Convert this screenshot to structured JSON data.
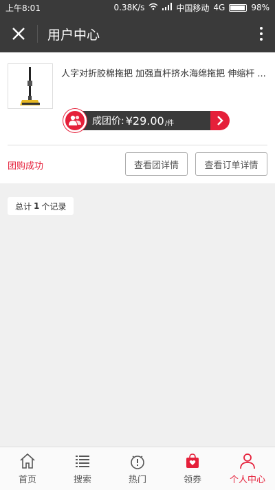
{
  "statusbar": {
    "time": "上午8:01",
    "speed": "0.38K/s",
    "carrier": "中国移动",
    "network": "4G",
    "battery": "98%"
  },
  "header": {
    "title": "用户中心"
  },
  "order": {
    "product_title": "人字对折胶棉拖把 加强直杆挤水海绵拖把 伸缩杆 ...",
    "price_label": "成团价:",
    "price_value": "¥29.00",
    "price_unit": "/件",
    "status": "团购成功",
    "group_details_button": "查看团详情",
    "order_details_button": "查看订单详情"
  },
  "summary": {
    "prefix": "总计",
    "count": "1",
    "suffix": "个记录"
  },
  "tabbar": {
    "items": [
      {
        "label": "首页",
        "icon": "home-icon"
      },
      {
        "label": "搜索",
        "icon": "list-icon"
      },
      {
        "label": "热门",
        "icon": "hot-icon"
      },
      {
        "label": "领券",
        "icon": "coupon-bag-icon"
      },
      {
        "label": "个人中心",
        "icon": "person-icon"
      }
    ],
    "active_index": 4
  },
  "colors": {
    "accent": "#e5203a",
    "header_bg": "#3a3a3a"
  }
}
